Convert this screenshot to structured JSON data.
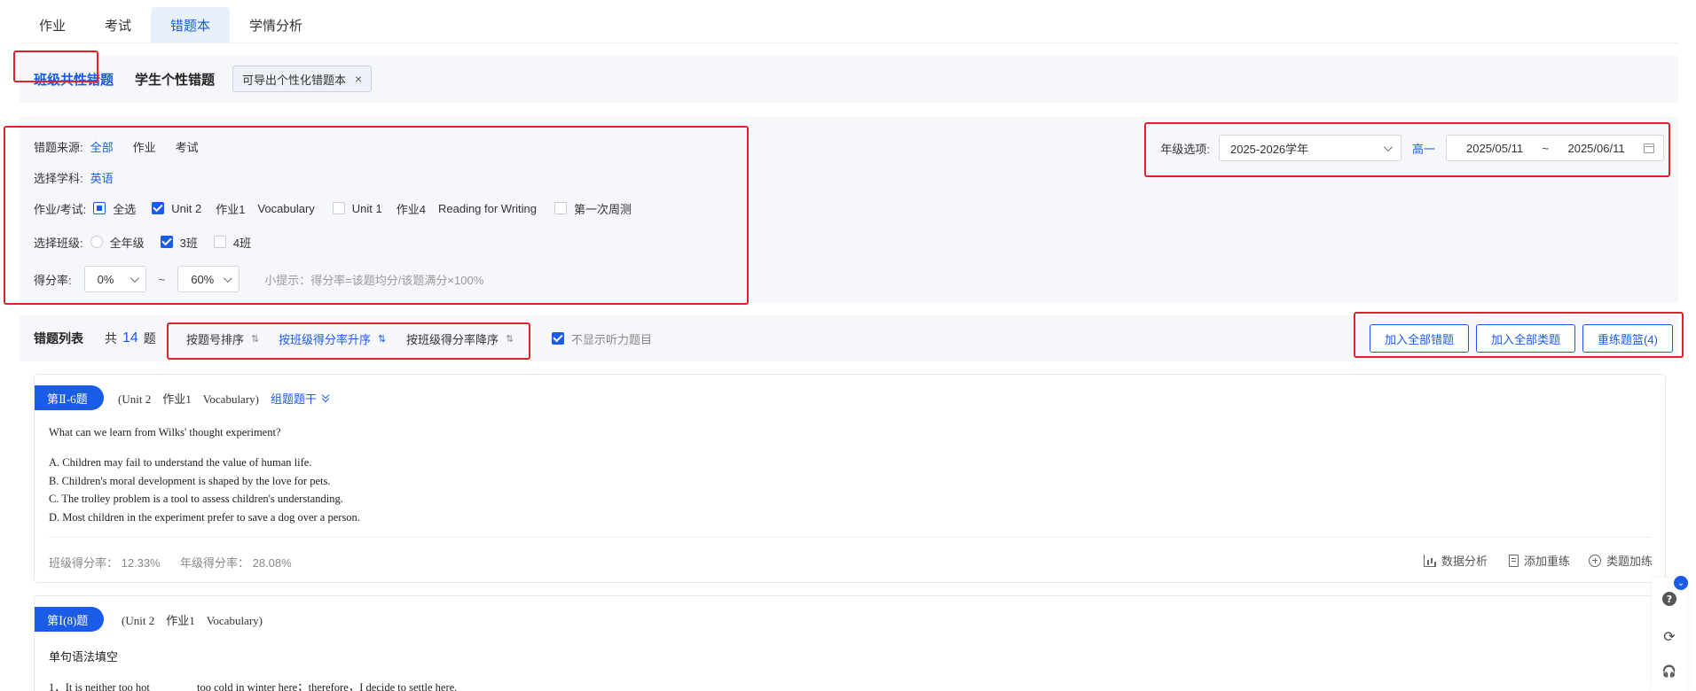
{
  "top_tabs": [
    "作业",
    "考试",
    "错题本",
    "学情分析"
  ],
  "mode": {
    "class_label": "班级共性错题",
    "personal_label": "学生个性错题",
    "tag_label": "可导出个性化错题本",
    "tag_close": "×"
  },
  "filters": {
    "source_label": "错题来源:",
    "source_options": [
      "全部",
      "作业",
      "考试"
    ],
    "subject_label": "选择学科:",
    "subject_value": "英语",
    "assign_label": "作业/考试:",
    "assign_options": [
      "全选",
      "Unit 2",
      "作业1",
      "Vocabulary",
      "Unit 1",
      "作业4",
      "Reading for Writing",
      "第一次周测"
    ],
    "class_label": "选择班级:",
    "class_options": [
      "全年级",
      "3班",
      "4班"
    ],
    "score_label": "得分率:",
    "score_from": "0%",
    "score_tilde": "~",
    "score_to": "60%",
    "tip": "小提示：得分率=该题均分/该题满分×100%"
  },
  "grade": {
    "label": "年级选项:",
    "year": "2025-2026学年",
    "name": "高一",
    "date_from": "2025/05/11",
    "date_sep": "~",
    "date_to": "2025/06/11"
  },
  "list": {
    "title": "错题列表",
    "count_prefix": "共",
    "count": "14",
    "count_suffix": "题",
    "sort_options": [
      "按题号排序",
      "按班级得分率升序",
      "按班级得分率降序"
    ],
    "sort_icon": "⇅",
    "hide_listening": "不显示听力题目",
    "actions": [
      "加入全部错题",
      "加入全部类题",
      "重练题篮(4)"
    ]
  },
  "questions": [
    {
      "badge": "第Ⅱ-6题",
      "source": "(Unit 2　作业1　Vocabulary)",
      "group_label": "组题题干",
      "stem": "What can we learn from Wilks' thought experiment?",
      "options": [
        "A. Children may fail to understand the value of human life.",
        "B. Children's moral development is shaped by the love for pets.",
        "C. The trolley problem is a tool to assess children's understanding.",
        "D. Most children in the experiment prefer to save a dog over a person."
      ],
      "class_rate": "班级得分率： 12.33%",
      "grade_rate": "年级得分率： 28.08%",
      "actions": [
        "数据分析",
        "添加重练",
        "类题加练"
      ]
    },
    {
      "badge": "第Ⅰ(8)题",
      "source": "(Unit 2　作业1　Vocabulary)",
      "title": "单句语法填空",
      "line1": "1．It is neither too hot ________too cold in winter here；therefore，I decide to settle here."
    }
  ],
  "side_tools": {
    "collapse": "⌄",
    "help": "?",
    "refresh": "⟳",
    "headset": "🎧"
  },
  "colors": {
    "accent": "#1a5ce6",
    "highlight_box": "#e0202a",
    "panel_bg": "#f5f7fb"
  }
}
